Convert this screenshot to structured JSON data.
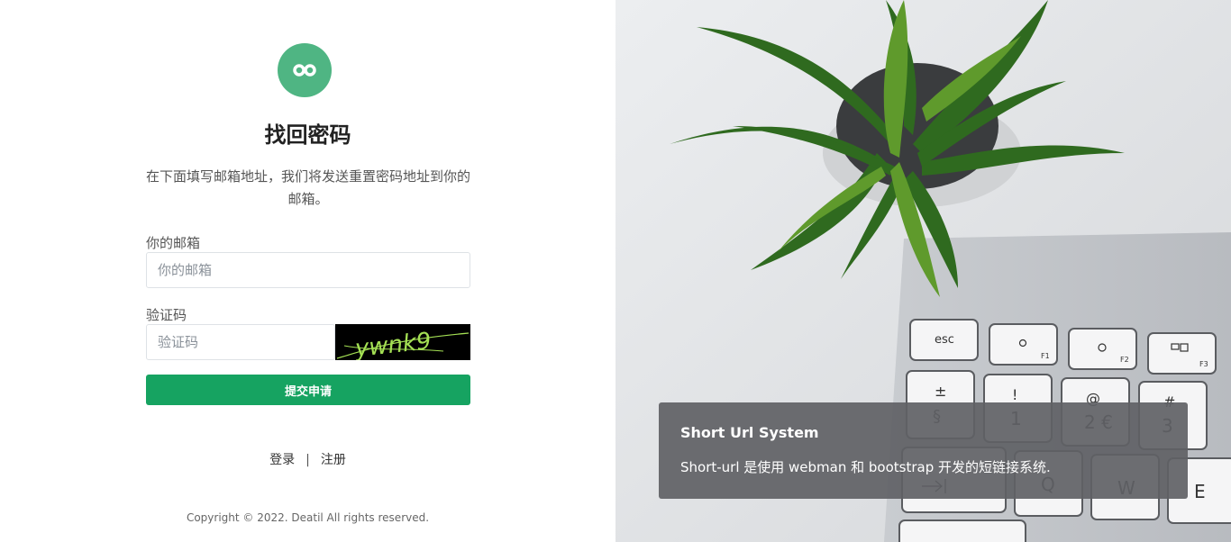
{
  "form": {
    "title": "找回密码",
    "description": "在下面填写邮箱地址，我们将发送重置密码地址到你的邮箱。",
    "email_label": "你的邮箱",
    "email_placeholder": "你的邮箱",
    "email_value": "",
    "captcha_label": "验证码",
    "captcha_placeholder": "验证码",
    "captcha_value": "",
    "captcha_image_text": "ywnk9",
    "submit_label": "提交申请"
  },
  "links": {
    "login": "登录",
    "separator": "|",
    "register": "注册"
  },
  "footer": {
    "copyright": "Copyright © 2022. Deatil All rights reserved."
  },
  "hero": {
    "title": "Short Url System",
    "text": "Short-url 是使用 webman 和 bootstrap 开发的短链接系统."
  },
  "colors": {
    "logo": "#4fb583",
    "submit": "#16a361",
    "captcha_text": "#a4e054"
  },
  "icons": {
    "logo": "infinity-icon"
  },
  "keyboard_keys": [
    "esc",
    "F1",
    "F2",
    "F3",
    "±",
    "§",
    "!",
    "1",
    "@",
    "2 €",
    "#",
    "3",
    "Q",
    "W",
    "E"
  ]
}
